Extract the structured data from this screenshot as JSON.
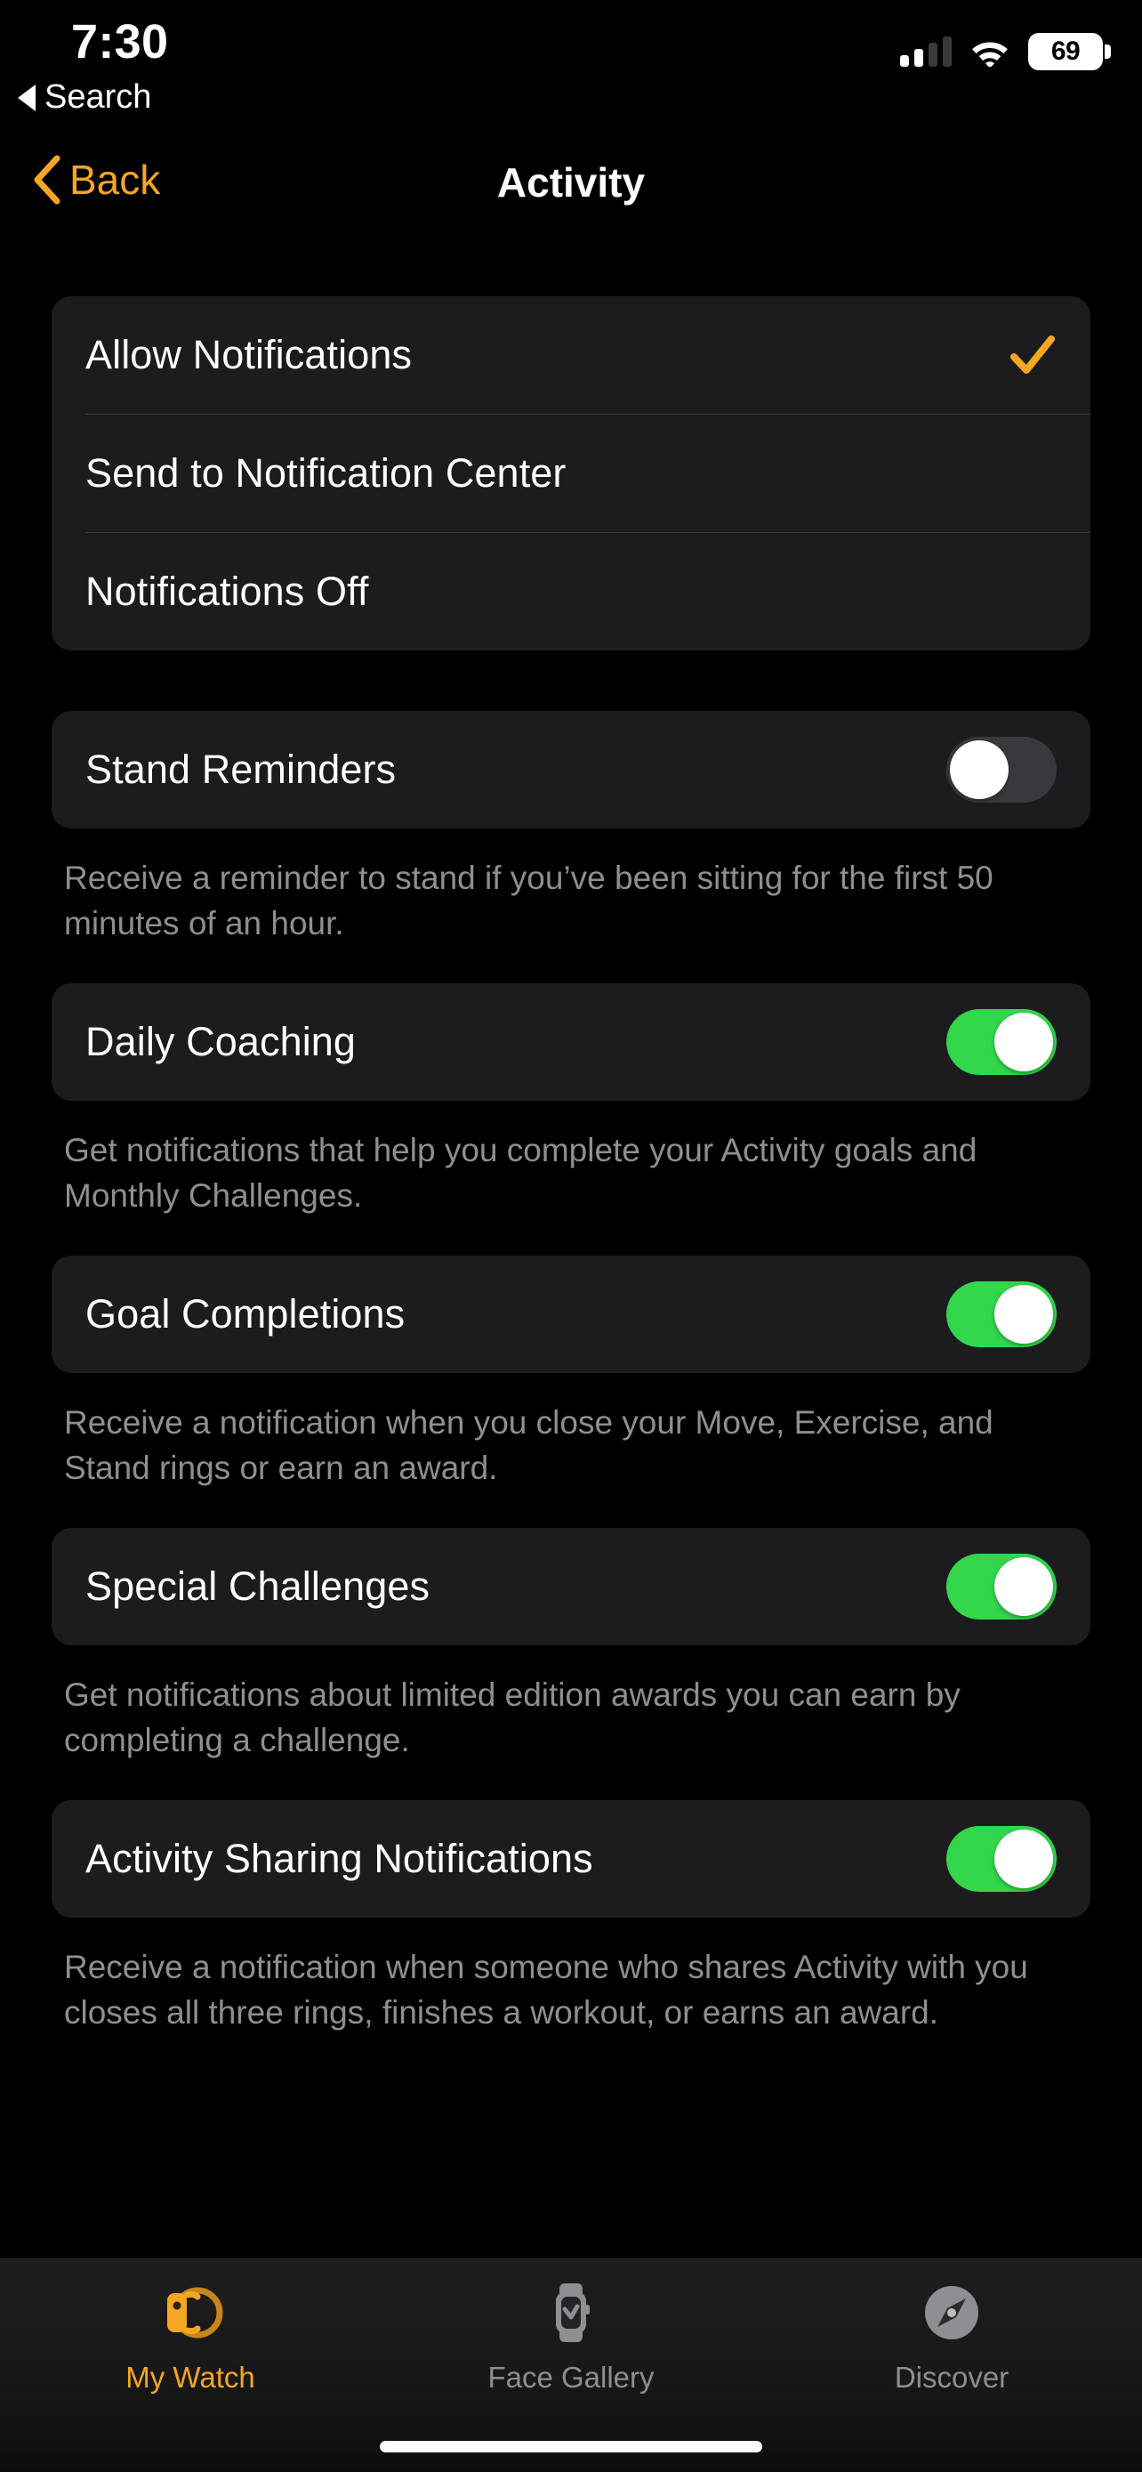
{
  "status_bar": {
    "time": "7:30",
    "return_to_label": "Search",
    "return_caret_icon": "triangle-left-icon",
    "signal_icon": "cellular-signal-icon",
    "signal_bars_filled": 2,
    "signal_bars_total": 4,
    "wifi_icon": "wifi-icon",
    "battery_icon": "battery-icon",
    "battery_level": "69"
  },
  "nav_bar": {
    "back_label": "Back",
    "back_icon": "chevron-left-icon",
    "title": "Activity"
  },
  "notification_style": {
    "options": [
      {
        "label": "Allow Notifications",
        "selected": true,
        "check_icon": "checkmark-icon"
      },
      {
        "label": "Send to Notification Center",
        "selected": false
      },
      {
        "label": "Notifications Off",
        "selected": false
      }
    ]
  },
  "settings": [
    {
      "label": "Stand Reminders",
      "toggle_state": "off",
      "footnote": "Receive a reminder to stand if you’ve been sitting for the first 50 minutes of an hour."
    },
    {
      "label": "Daily Coaching",
      "toggle_state": "on",
      "footnote": "Get notifications that help you complete your Activity goals and Monthly Challenges."
    },
    {
      "label": "Goal Completions",
      "toggle_state": "on",
      "footnote": "Receive a notification when you close your Move, Exercise, and Stand rings or earn an award."
    },
    {
      "label": "Special Challenges",
      "toggle_state": "on",
      "footnote": "Get notifications about limited edition awards you can earn by completing a challenge."
    },
    {
      "label": "Activity Sharing Notifications",
      "toggle_state": "on",
      "footnote": "Receive a notification when someone who shares Activity with you closes all three rings, finishes a workout, or earns an award."
    }
  ],
  "tab_bar": {
    "tabs": [
      {
        "label": "My Watch",
        "icon": "watch-side-icon",
        "active": true
      },
      {
        "label": "Face Gallery",
        "icon": "watch-face-icon",
        "active": false
      },
      {
        "label": "Discover",
        "icon": "compass-icon",
        "active": false
      }
    ]
  },
  "colors": {
    "accent_orange": "#F5A623",
    "toggle_on_green": "#32D74B",
    "toggle_off_gray": "#39393D",
    "card_background": "#1C1C1E",
    "footnote_gray": "#8E8E93",
    "page_background": "#000000"
  }
}
